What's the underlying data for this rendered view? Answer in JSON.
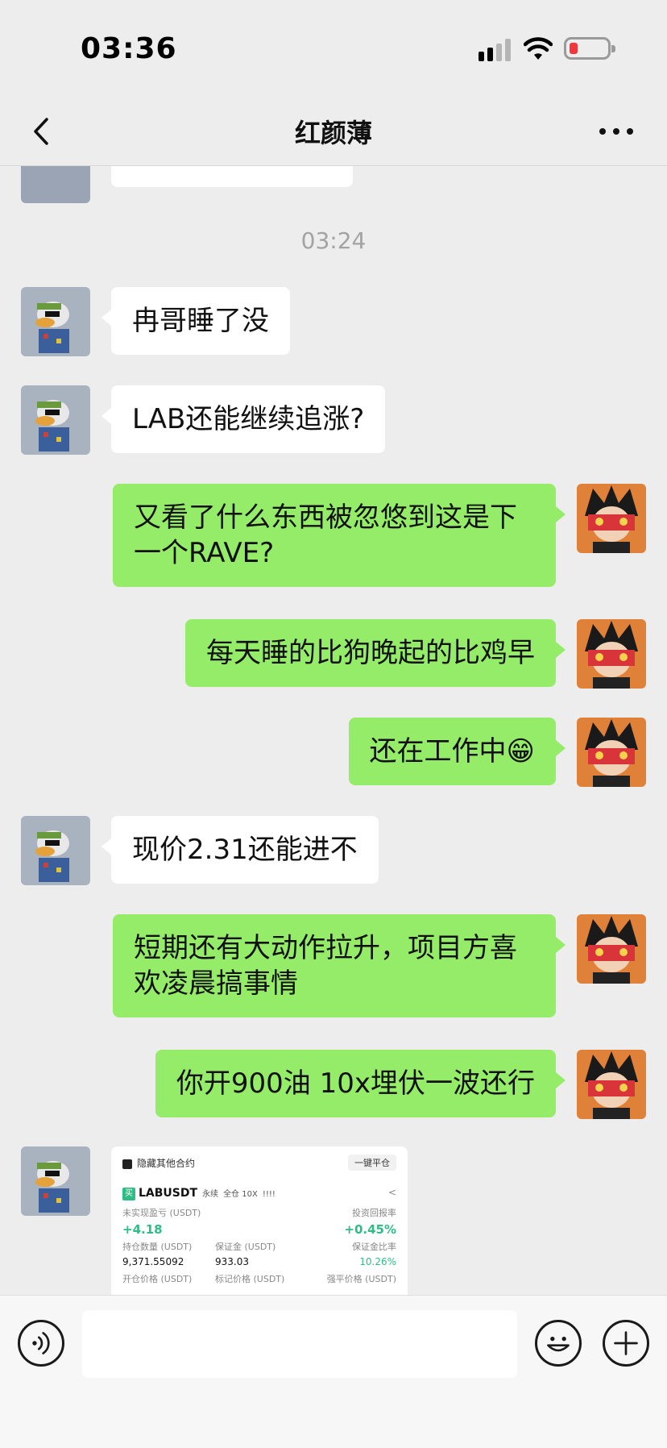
{
  "status_bar": {
    "time": "03:36"
  },
  "nav": {
    "title": "红颜薄"
  },
  "chat": {
    "timestamp": "03:24",
    "messages": [
      {
        "side": "in",
        "text": "冉哥睡了没"
      },
      {
        "side": "in",
        "text": "LAB还能继续追涨?"
      },
      {
        "side": "out",
        "text": "又看了什么东西被忽悠到这是下一个RAVE?"
      },
      {
        "side": "out",
        "text": "每天睡的比狗晚起的比鸡早"
      },
      {
        "side": "out",
        "text": "还在工作中😁"
      },
      {
        "side": "in",
        "text": "现价2.31还能进不"
      },
      {
        "side": "out",
        "text": "短期还有大动作拉升，项目方喜欢凌晨搞事情"
      },
      {
        "side": "out",
        "text": "你开900油 10x埋伏一波还行"
      }
    ]
  },
  "trade_card": {
    "hide_label": "隐藏其他合约",
    "close_all": "一键平仓",
    "symbol": "LABUSDT",
    "type": "永续",
    "mode": "全仓 10X",
    "bars": "!!!!",
    "pnl_label": "未实现盈亏 (USDT)",
    "pnl_value": "+4.18",
    "roe_label": "投资回报率",
    "roe_value": "+0.45%",
    "size_label": "持仓数量 (USDT)",
    "size_value": "9,371.55092",
    "margin_label": "保证金 (USDT)",
    "margin_value": "933.03",
    "ratio_label": "保证金比率",
    "ratio_value": "10.26%",
    "entry_label": "开仓价格 (USDT)",
    "mark_label": "标记价格 (USDT)",
    "liq_label": "强平价格 (USDT)"
  },
  "input": {
    "placeholder": ""
  },
  "colors": {
    "bubble_out": "#95ec69",
    "bubble_in": "#ffffff",
    "background": "#ededed"
  }
}
